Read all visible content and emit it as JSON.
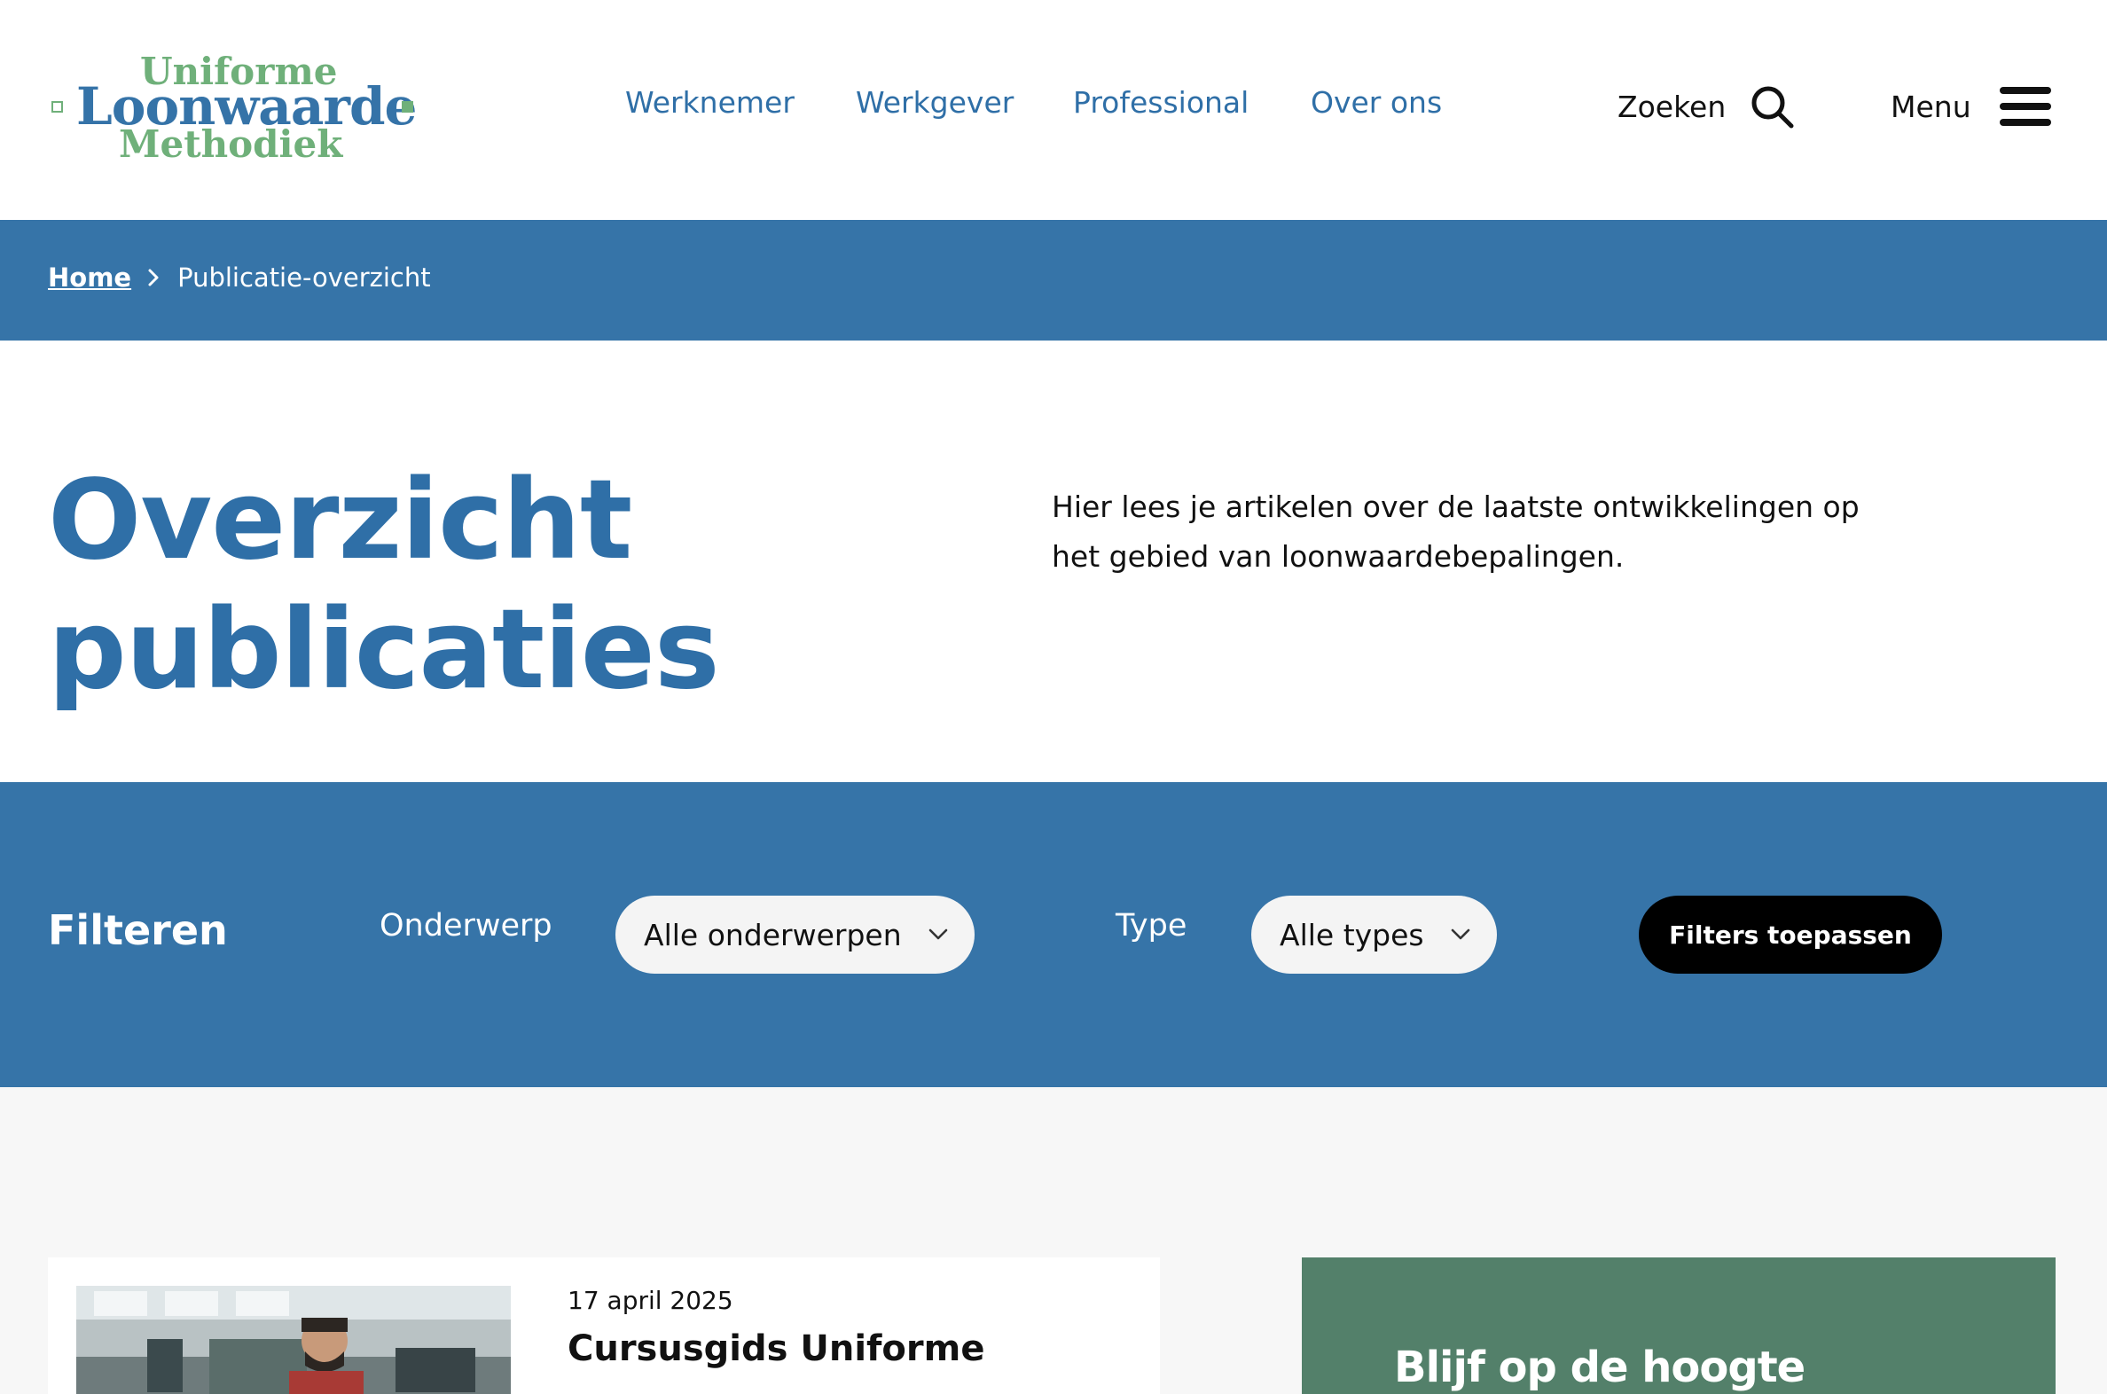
{
  "brand": {
    "line1": "Uniforme",
    "line2": "Loonwaarde",
    "line3": "Methodiek",
    "colors": {
      "blue": "#2f6fa7",
      "green": "#6fb07a"
    }
  },
  "nav": {
    "items": [
      {
        "label": "Werknemer"
      },
      {
        "label": "Werkgever"
      },
      {
        "label": "Professional"
      },
      {
        "label": "Over ons"
      }
    ],
    "search_label": "Zoeken",
    "search_icon": "search-icon",
    "menu_label": "Menu",
    "menu_icon": "hamburger-icon"
  },
  "breadcrumb": {
    "home": "Home",
    "current": "Publicatie-overzicht"
  },
  "hero": {
    "title": "Overzicht publicaties",
    "intro": "Hier lees je artikelen over de laatste ontwikkelingen op het gebied van loonwaardebepalingen."
  },
  "filters": {
    "title": "Filteren",
    "topic_label": "Onderwerp",
    "topic_value": "Alle onderwerpen",
    "type_label": "Type",
    "type_value": "Alle types",
    "apply_label": "Filters toepassen"
  },
  "publications": [
    {
      "date": "17 april 2025",
      "title": "Cursusgids Uniforme"
    }
  ],
  "newsletter": {
    "title": "Blijf op de hoogte"
  },
  "colors": {
    "primary": "#3674a8",
    "green_panel": "#53806a",
    "button": "#000000"
  }
}
